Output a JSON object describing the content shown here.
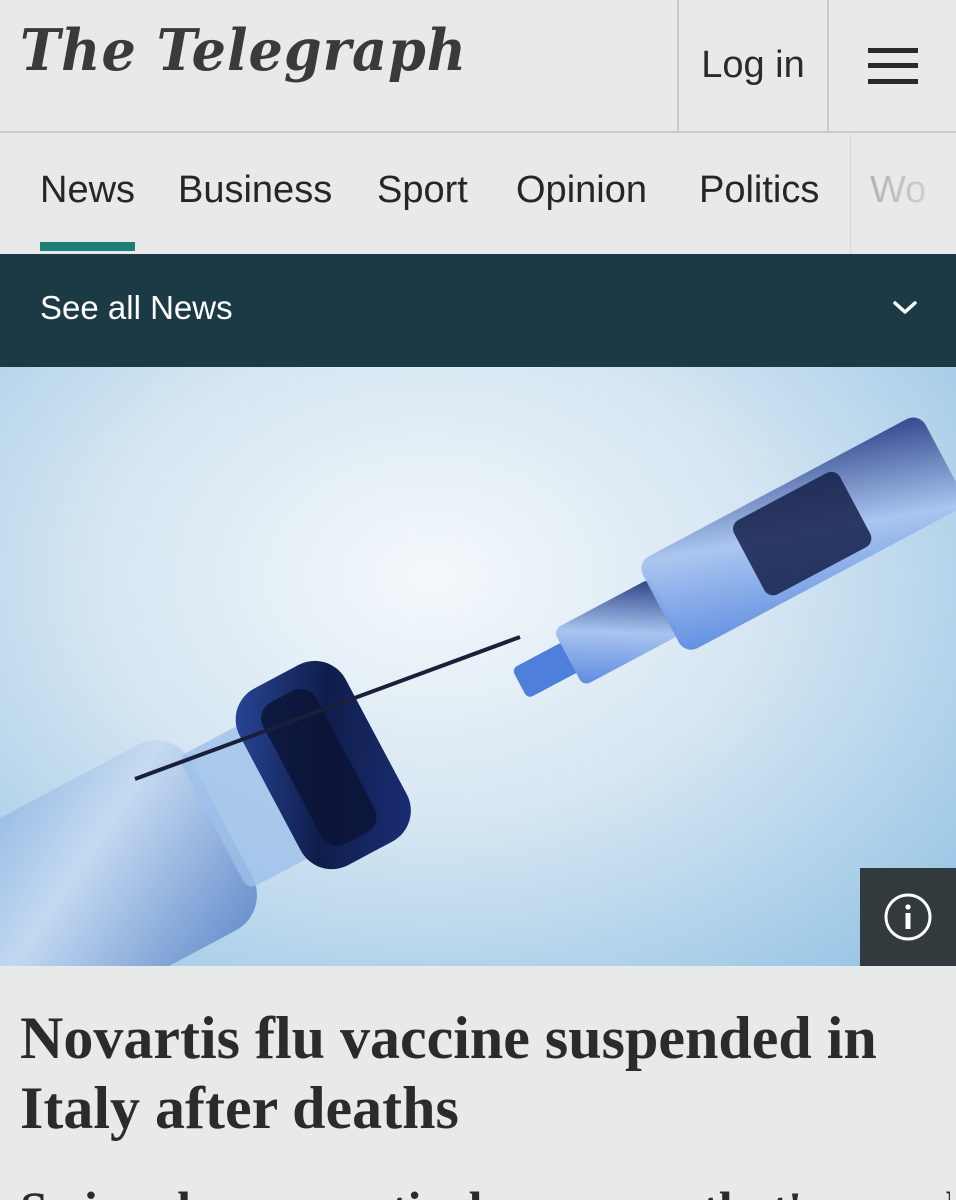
{
  "header": {
    "logo_text": "The Telegraph",
    "login_label": "Log in",
    "menu_icon": "hamburger-menu-icon"
  },
  "nav": {
    "items": [
      {
        "label": "News",
        "active": true
      },
      {
        "label": "Business",
        "active": false
      },
      {
        "label": "Sport",
        "active": false
      },
      {
        "label": "Opinion",
        "active": false
      },
      {
        "label": "Politics",
        "active": false
      },
      {
        "label": "Wo",
        "active": false
      }
    ],
    "accent_color": "#1d7d78"
  },
  "section_bar": {
    "label": "See all News",
    "icon": "chevron-down-icon",
    "background": "#1b3a46"
  },
  "hero": {
    "icon": "info-icon"
  },
  "article": {
    "headline": "Novartis flu vaccine suspended in Italy after deaths",
    "standfirst": "Swiss pharmaceutical company that's urged"
  }
}
